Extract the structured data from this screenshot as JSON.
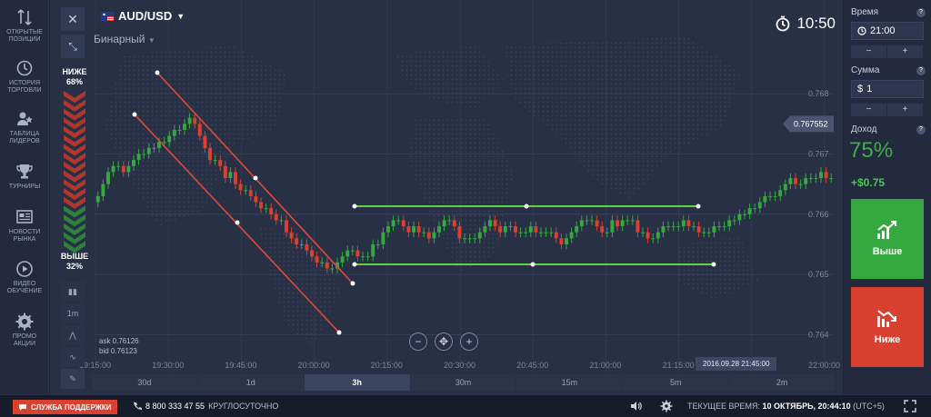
{
  "nav": [
    {
      "name": "open-positions",
      "icon": "arrows-up-down-icon",
      "label": "ОТКРЫТЫЕ\nПОЗИЦИИ"
    },
    {
      "name": "trade-history",
      "icon": "history-icon",
      "label": "ИСТОРИЯ\nТОРГОВЛИ"
    },
    {
      "name": "leaderboard",
      "icon": "leaders-icon",
      "label": "ТАБЛИЦА\nЛИДЕРОВ"
    },
    {
      "name": "tournaments",
      "icon": "trophy-icon",
      "label": "ТУРНИРЫ"
    },
    {
      "name": "market-news",
      "icon": "news-icon",
      "label": "НОВОСТИ\nРЫНКА"
    },
    {
      "name": "video-training",
      "icon": "play-icon",
      "label": "ВИДЕО\nОБУЧЕНИЕ"
    },
    {
      "name": "promotions",
      "icon": "gear-promo-icon",
      "label": "ПРОМО\nАКЦИИ"
    }
  ],
  "chart_header": {
    "pair": "AUD/USD",
    "mode": "Бинарный",
    "timer": "10:50"
  },
  "sentiment": {
    "lower_label": "НИЖЕ",
    "lower_pct": "68%",
    "higher_label": "ВЫШЕ",
    "higher_pct": "32%",
    "lower_fraction": 0.68
  },
  "chart_tools": [
    "1m"
  ],
  "askbid": {
    "ask": "ask 0.76126",
    "bid": "bid 0.76123"
  },
  "cursor_time": "2016.09.28 21:45:00",
  "timeframes": [
    {
      "label": "30d",
      "active": false
    },
    {
      "label": "1d",
      "active": false
    },
    {
      "label": "3h",
      "active": true
    },
    {
      "label": "30m",
      "active": false
    },
    {
      "label": "15m",
      "active": false
    },
    {
      "label": "5m",
      "active": false
    },
    {
      "label": "2m",
      "active": false
    }
  ],
  "zoom": {
    "minus": "−",
    "plus": "+"
  },
  "chart_data": {
    "type": "candlestick",
    "current_price": "0.767552",
    "y_ticks": [
      "0.768",
      "0.767",
      "0.766",
      "0.765",
      "0.764"
    ],
    "x_ticks": [
      "19:15:00",
      "19:30:00",
      "19:45:00",
      "20:00:00",
      "20:15:00",
      "20:30:00",
      "20:45:00",
      "21:00:00",
      "21:15:00",
      "21:30:00",
      "22:00:00"
    ],
    "ylim": [
      0.7636,
      0.7685
    ],
    "closes": [
      0.7663,
      0.7665,
      0.7667,
      0.7668,
      0.7668,
      0.7667,
      0.7668,
      0.7669,
      0.767,
      0.767,
      0.7671,
      0.7671,
      0.7672,
      0.7672,
      0.7673,
      0.7674,
      0.7674,
      0.7675,
      0.7676,
      0.7675,
      0.7673,
      0.7671,
      0.7669,
      0.7669,
      0.7668,
      0.7666,
      0.7667,
      0.7665,
      0.7664,
      0.7664,
      0.7663,
      0.7662,
      0.7661,
      0.7661,
      0.766,
      0.7659,
      0.7659,
      0.7657,
      0.7656,
      0.7655,
      0.7655,
      0.7654,
      0.7653,
      0.7652,
      0.7652,
      0.7651,
      0.7651,
      0.7652,
      0.7653,
      0.7654,
      0.7654,
      0.7653,
      0.7653,
      0.7653,
      0.7655,
      0.7655,
      0.7657,
      0.7658,
      0.7659,
      0.7659,
      0.7658,
      0.7657,
      0.7658,
      0.7657,
      0.7657,
      0.7656,
      0.7657,
      0.7658,
      0.7659,
      0.7659,
      0.7658,
      0.7656,
      0.7656,
      0.7656,
      0.7656,
      0.7657,
      0.7658,
      0.7659,
      0.7658,
      0.7657,
      0.7658,
      0.7658,
      0.7657,
      0.7657,
      0.7657,
      0.7658,
      0.7657,
      0.7657,
      0.7657,
      0.7657,
      0.7656,
      0.7655,
      0.7656,
      0.7657,
      0.7658,
      0.7659,
      0.7659,
      0.7659,
      0.7658,
      0.7657,
      0.7657,
      0.7659,
      0.7658,
      0.7659,
      0.7659,
      0.7659,
      0.7657,
      0.7657,
      0.7656,
      0.7656,
      0.7657,
      0.7658,
      0.7658,
      0.7658,
      0.7658,
      0.7659,
      0.7658,
      0.7658,
      0.7657,
      0.7657,
      0.7657,
      0.7658,
      0.7658,
      0.7658,
      0.7659,
      0.7659,
      0.766,
      0.766,
      0.7661,
      0.7661,
      0.7662,
      0.7663,
      0.7663,
      0.7663,
      0.7664,
      0.7665,
      0.7666,
      0.7665,
      0.7665,
      0.7666,
      0.7666,
      0.7666,
      0.7667,
      0.7666,
      0.7666
    ]
  },
  "right": {
    "time_label": "Время",
    "time_value": "21:00",
    "amount_label": "Сумма",
    "amount_currency": "$",
    "amount_value": "1",
    "minus": "−",
    "plus": "+",
    "income_label": "Доход",
    "help": "?",
    "payout": "75%",
    "profit": "+$0.75",
    "up_label": "Выше",
    "down_label": "Ниже"
  },
  "colors": {
    "up": "#35a940",
    "down": "#d8412f",
    "line_green": "#5fd33f",
    "line_red": "#e04a38"
  },
  "status": {
    "support": "СЛУЖБА ПОДДЕРЖКИ",
    "phone": "8 800 333 47 55",
    "hours": "КРУГЛОСУТОЧНО",
    "server_label": "ТЕКУЩЕЕ ВРЕМЯ:",
    "server_value": "10 ОКТЯБРЬ, 20:44:10",
    "server_tz": "(UTC+5)"
  }
}
